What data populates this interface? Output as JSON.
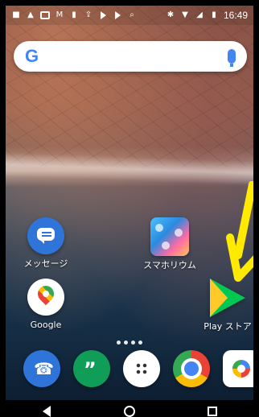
{
  "status_bar": {
    "time": "16:49",
    "icons": [
      "chat-icon",
      "warning-icon",
      "gallery-icon",
      "gmail-icon",
      "usb-icon",
      "upload-icon",
      "youtube-icon",
      "youtube-icon",
      "search-icon",
      "bluetooth-icon",
      "wifi-icon",
      "signal-icon",
      "battery-icon"
    ]
  },
  "search": {
    "logo": "G"
  },
  "home": {
    "apps": [
      {
        "label": "メッセージ",
        "icon": "messages-icon"
      },
      {
        "label": "スマホリウム",
        "icon": "sumahor-icon"
      },
      {
        "label": "Google",
        "icon": "google-maps-icon"
      },
      {
        "label": "Play ストア",
        "icon": "play-store-icon"
      }
    ]
  },
  "dock": {
    "apps": [
      {
        "icon": "phone-icon"
      },
      {
        "icon": "hangouts-icon"
      },
      {
        "icon": "app-drawer-icon"
      },
      {
        "icon": "chrome-icon"
      },
      {
        "icon": "camera-icon"
      }
    ]
  },
  "nav": {
    "buttons": [
      "back",
      "home",
      "recents"
    ]
  },
  "colors": {
    "google_blue": "#4285F4",
    "google_red": "#ea4335",
    "google_yellow": "#fbbc05",
    "google_green": "#34a853",
    "play_green": "#00c853",
    "annotation_yellow": "#ffea00"
  }
}
